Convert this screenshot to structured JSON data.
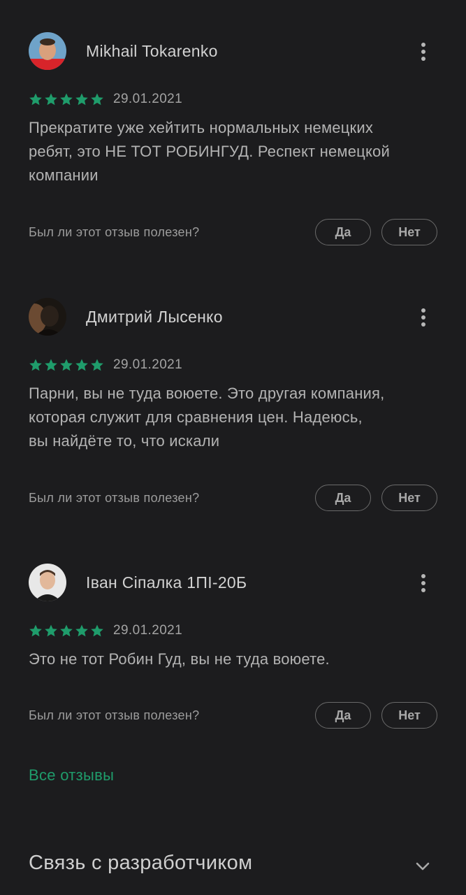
{
  "reviews": [
    {
      "author": "Mikhail Tokarenko",
      "avatar_icon": "avatar-red-shirt",
      "rating": 5,
      "date": "29.01.2021",
      "text": "Прекратите уже хейтить нормальных немецких\nребят, это НЕ ТОТ РОБИНГУД. Респект немецкой\nкомпании",
      "helpful_question": "Был ли этот отзыв полезен?",
      "yes_label": "Да",
      "no_label": "Нет"
    },
    {
      "author": "Дмитрий Лысенко",
      "avatar_icon": "avatar-dark-portrait",
      "rating": 5,
      "date": "29.01.2021",
      "text": "Парни, вы не туда воюете. Это другая компания,\nкоторая служит для сравнения цен. Надеюсь,\nвы найдёте то, что искали",
      "helpful_question": "Был ли этот отзыв полезен?",
      "yes_label": "Да",
      "no_label": "Нет"
    },
    {
      "author": "Іван Сіпалка 1ПІ-20Б",
      "avatar_icon": "avatar-light-portrait",
      "rating": 5,
      "date": "29.01.2021",
      "text": "Это не тот Робин Гуд, вы не туда воюете.",
      "helpful_question": "Был ли этот отзыв полезен?",
      "yes_label": "Да",
      "no_label": "Нет"
    }
  ],
  "all_reviews_label": "Все отзывы",
  "contact_section_title": "Связь с разработчиком",
  "icons": {
    "more": "more-vert-icon",
    "star": "star-icon",
    "expand": "chevron-down-icon"
  },
  "colors": {
    "background": "#1c1c1e",
    "star": "#1f9c6b",
    "link": "#1f9c6b"
  }
}
